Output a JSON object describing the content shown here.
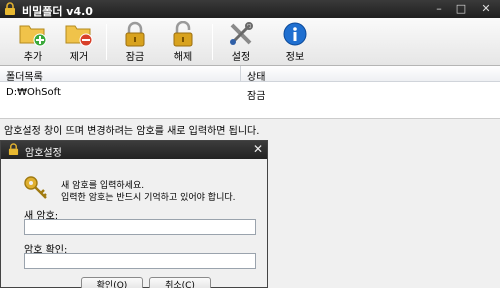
{
  "window": {
    "title": "비밀폴더 v4.0",
    "minimize": "–",
    "maximize": "□",
    "close": "✕"
  },
  "toolbar": [
    {
      "id": "add",
      "label": "추가",
      "icon": "folder-add-icon"
    },
    {
      "id": "remove",
      "label": "제거",
      "icon": "folder-remove-icon"
    },
    {
      "id": "lock",
      "label": "잠금",
      "icon": "lock-icon"
    },
    {
      "id": "unlock",
      "label": "해제",
      "icon": "unlock-icon"
    },
    {
      "id": "settings",
      "label": "설정",
      "icon": "tools-icon"
    },
    {
      "id": "info",
      "label": "정보",
      "icon": "info-icon"
    }
  ],
  "list": {
    "columns": [
      "폴더목록",
      "상태"
    ],
    "rows": [
      {
        "folder": "D:₩OhSoft",
        "status": "잠금"
      }
    ]
  },
  "status_message": "암호설정 창이 뜨며 변경하려는 암호를 새로 입력하면 됩니다.",
  "dialog": {
    "title": "암호설정",
    "close": "✕",
    "message_line1": "새 암호를 입력하세요.",
    "message_line2": "입력한 암호는 반드시 기억하고 있어야 합니다.",
    "new_password_label": "새 암호:",
    "new_password_value": "",
    "confirm_password_label": "암호 확인:",
    "confirm_password_value": "",
    "ok_button": "확인(O)",
    "cancel_button": "취소(C)"
  },
  "colors": {
    "title_bar": "#2a2a2a",
    "lock_gold": "#d8a21e",
    "folder_yellow": "#f0c34a",
    "info_blue": "#1f6fd0"
  }
}
